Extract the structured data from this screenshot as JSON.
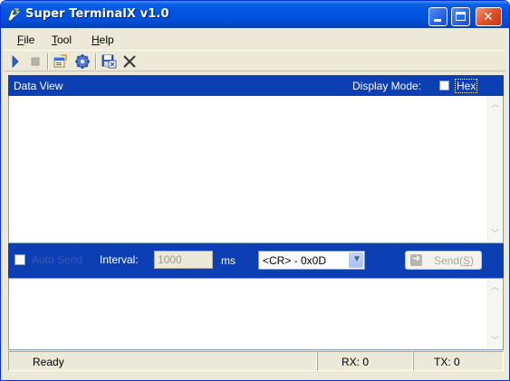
{
  "window": {
    "title": "Super TerminalX v1.0",
    "controls": [
      "minimize-icon",
      "maximize-icon",
      "close-icon"
    ]
  },
  "menu": {
    "file": {
      "accel": "F",
      "rest": "ile"
    },
    "tool": {
      "accel": "T",
      "rest": "ool"
    },
    "help": {
      "accel": "H",
      "rest": "elp"
    }
  },
  "toolbar": {
    "icons": [
      "play-icon",
      "stop-icon",
      "properties-icon",
      "settings-gear-icon",
      "save-icon",
      "clear-x-icon"
    ]
  },
  "data_view": {
    "title": "Data View",
    "display_mode_label": "Display Mode:",
    "hex_label": "Hex",
    "hex_checked": false,
    "content": ""
  },
  "send_bar": {
    "auto_send_label": "Auto Send",
    "auto_send_checked": false,
    "interval_label": "Interval:",
    "interval_value": "1000",
    "interval_unit": "ms",
    "line_ending_selected": "<CR> - 0x0D",
    "send_button": {
      "label": "Send(",
      "accel": "S",
      "suffix": ")"
    }
  },
  "send_input": {
    "content": ""
  },
  "status": {
    "message": "Ready",
    "rx": "RX: 0",
    "tx": "TX: 0"
  },
  "colors": {
    "title_bar": "#0054e3",
    "panel_header": "#0c3fb4",
    "window_face": "#ece9d8"
  }
}
